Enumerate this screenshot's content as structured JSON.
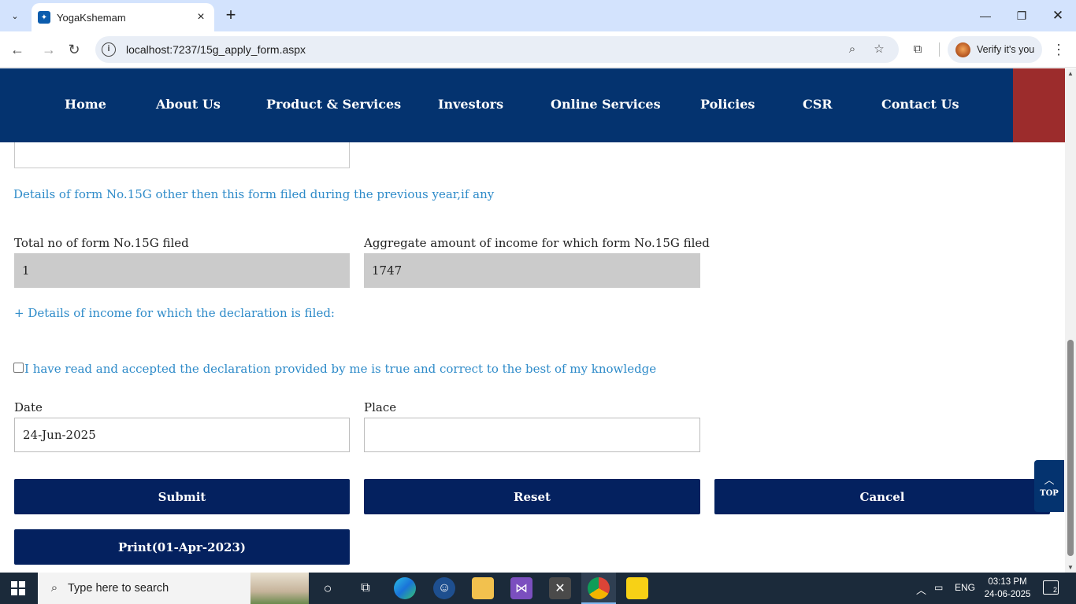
{
  "browser": {
    "tab_title": "YogaKshemam",
    "url": "localhost:7237/15g_apply_form.aspx",
    "verify_label": "Verify it's you"
  },
  "site_nav": {
    "items": [
      "Home",
      "About Us",
      "Product & Services",
      "Investors",
      "Online Services",
      "Policies",
      "CSR",
      "Contact Us"
    ]
  },
  "form": {
    "other_forms_heading": "Details of form No.15G other then this form filed during the previous year,if any",
    "total_forms_label": "Total no of form No.15G filed",
    "total_forms_value": "1",
    "aggregate_label": "Aggregate amount of income for which form No.15G filed",
    "aggregate_value": "1747",
    "income_details_toggle": "+ Details of income for which the declaration is filed:",
    "declaration_text": "I have read and accepted the declaration provided by me is true and correct to the best of my knowledge",
    "declaration_checked": false,
    "date_label": "Date",
    "date_value": "24-Jun-2025",
    "place_label": "Place",
    "place_value": ""
  },
  "buttons": {
    "submit": "Submit",
    "reset": "Reset",
    "cancel": "Cancel",
    "print": "Print(01-Apr-2023)",
    "top": "TOP"
  },
  "taskbar": {
    "search_placeholder": "Type here to search",
    "language": "ENG",
    "time": "03:13 PM",
    "date": "24-06-2025",
    "notification_count": "2"
  },
  "colors": {
    "nav_bg": "#04336f",
    "button_bg": "#04215f",
    "link_blue": "#2e8bc9",
    "accent_red": "#9c2c2c"
  }
}
